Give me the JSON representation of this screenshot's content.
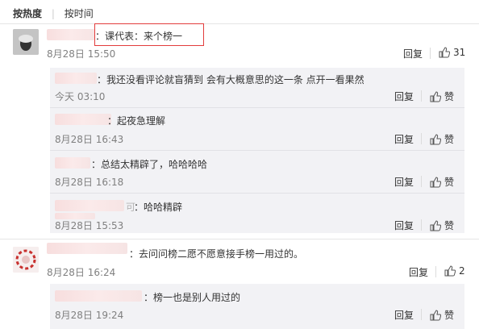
{
  "tabs": {
    "hot": "按热度",
    "time": "按时间"
  },
  "comments": [
    {
      "text": "：课代表：来个榜一",
      "time": "8月28日 15:50",
      "reply_label": "回复",
      "likes": "31",
      "replies": [
        {
          "text": "：我还没看评论就盲猜到 会有大概意思的这一条 点开一看果然",
          "time": "今天 03:10",
          "reply_label": "回复",
          "like_label": "赞"
        },
        {
          "text": "：起夜急理解",
          "time": "8月28日 16:43",
          "reply_label": "回复",
          "like_label": "赞"
        },
        {
          "text": "：总结太精辟了，哈哈哈哈",
          "time": "8月28日 16:18",
          "reply_label": "回复",
          "like_label": "赞"
        },
        {
          "name_tail": "可",
          "text": "：哈哈精辟",
          "time": "8月28日 15:53",
          "reply_label": "回复",
          "like_label": "赞"
        }
      ]
    },
    {
      "text": "：去问问榜二愿不愿意接手榜一用过的。",
      "time": "8月28日 16:24",
      "reply_label": "回复",
      "likes": "2",
      "replies": [
        {
          "text": "：榜一也是别人用过的",
          "time": "8月28日 19:24",
          "reply_label": "回复",
          "like_label": "赞"
        }
      ]
    }
  ]
}
